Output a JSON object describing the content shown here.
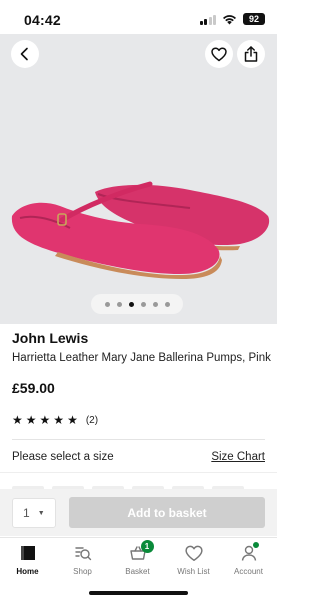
{
  "status_bar": {
    "time": "04:42",
    "battery": "92"
  },
  "product": {
    "brand": "John Lewis",
    "title": "Harrietta Leather Mary Jane Ballerina Pumps, Pink",
    "price": "£59.00",
    "rating_count": "(2)",
    "stars": 5,
    "image_index": 3,
    "image_count": 6,
    "shoe_color": "#e0356f"
  },
  "size": {
    "prompt": "Please select a size",
    "chart_link": "Size Chart"
  },
  "purchase": {
    "quantity": "1",
    "add_label": "Add to basket"
  },
  "tabbar": {
    "items": [
      {
        "label": "Home",
        "icon": "home-icon"
      },
      {
        "label": "Shop",
        "icon": "shop-search-icon"
      },
      {
        "label": "Basket",
        "icon": "basket-icon",
        "badge": "1"
      },
      {
        "label": "Wish List",
        "icon": "heart-icon"
      },
      {
        "label": "Account",
        "icon": "account-icon"
      }
    ]
  },
  "colors": {
    "accent_green": "#0a8a3a",
    "disabled_button": "#cfcfcf"
  }
}
